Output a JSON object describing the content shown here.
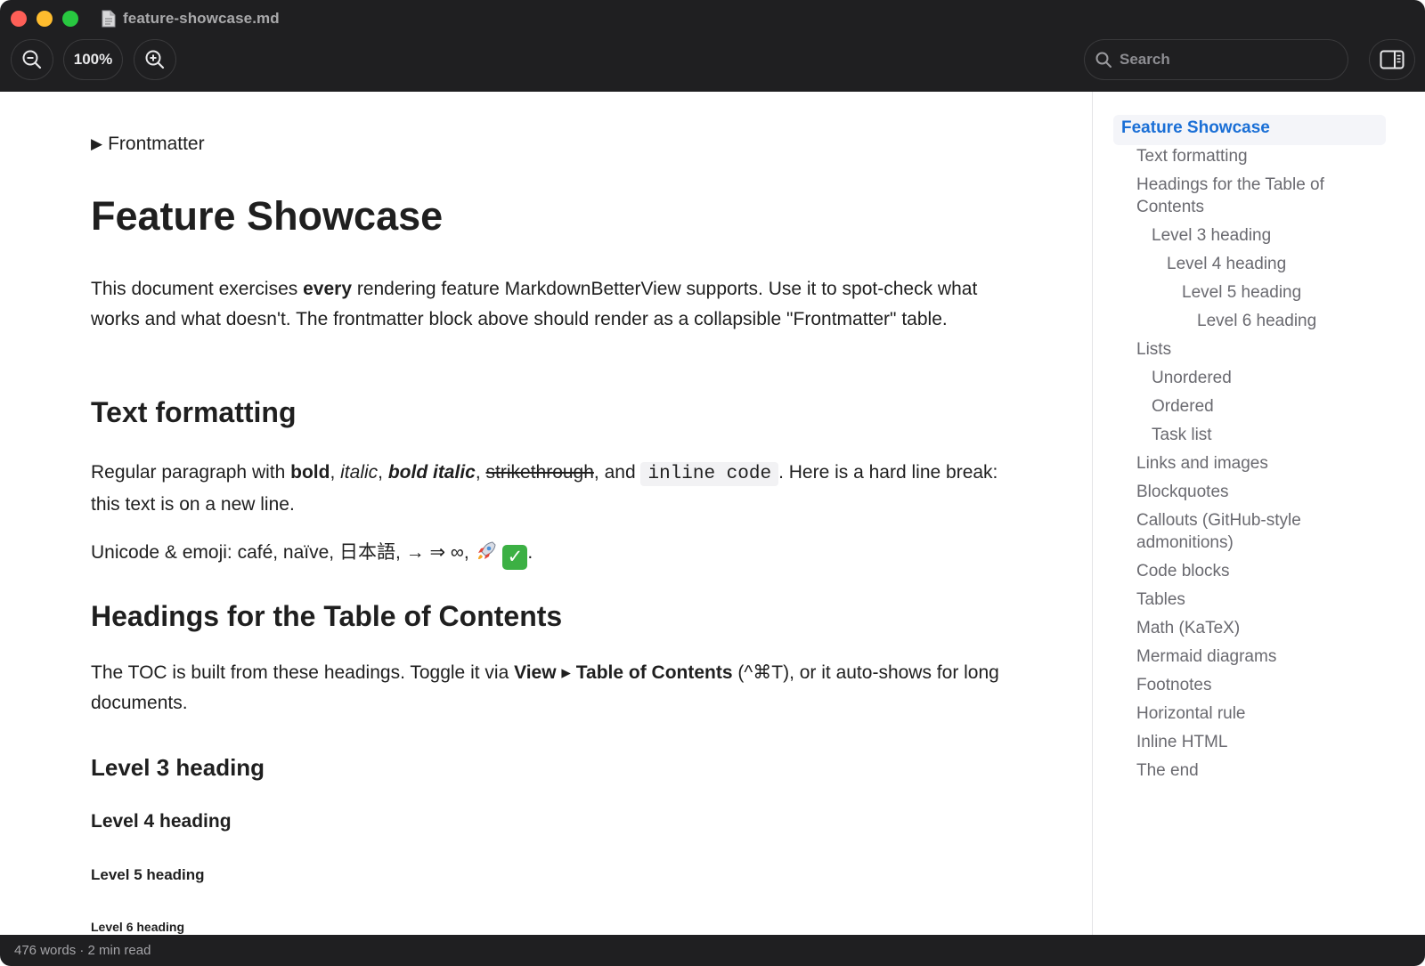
{
  "window": {
    "title": "feature-showcase.md"
  },
  "toolbar": {
    "zoom_level": "100%",
    "search_placeholder": "Search"
  },
  "content": {
    "frontmatter_label": "Frontmatter",
    "title": "Feature Showcase",
    "intro": {
      "t1": "This document exercises ",
      "b1": "every",
      "t2": " rendering feature MarkdownBetterView supports. Use it to spot-check what works and what doesn't. The frontmatter block above should render as a collapsible \"Frontmatter\" table."
    },
    "text_formatting_heading": "Text formatting",
    "formatting": {
      "t1": "Regular paragraph with ",
      "bold": "bold",
      "sep1": ", ",
      "italic": "italic",
      "sep2": ", ",
      "bold_italic": "bold italic",
      "sep3": ", ",
      "strike": "strikethrough",
      "t2": ", and ",
      "code": "inline code",
      "t3": ". Here is a hard line break: this text is on a new line."
    },
    "unicode_line": "Unicode & emoji: café, naïve, 日本語, → ⇒ ∞, ",
    "unicode_end": ".",
    "toc_heading": "Headings for the Table of Contents",
    "toc_para": {
      "t1": "The TOC is built from these headings. Toggle it via ",
      "b1": "View ▸ Table of Contents",
      "t2": " (^⌘T), or it auto-shows for long documents."
    },
    "h3": "Level 3 heading",
    "h4": "Level 4 heading",
    "h5": "Level 5 heading",
    "h6": "Level 6 heading"
  },
  "toc": [
    {
      "label": "Feature Showcase",
      "active": true
    },
    {
      "label": "Text formatting"
    },
    {
      "label": "Headings for the Table of"
    },
    {
      "label": "Contents"
    },
    {
      "label": "Level 3 heading"
    },
    {
      "label": "Level 4 heading"
    },
    {
      "label": "Level 5 heading"
    },
    {
      "label": "Level 6 heading"
    },
    {
      "label": "Lists"
    },
    {
      "label": "Unordered"
    },
    {
      "label": "Ordered"
    },
    {
      "label": "Task list"
    },
    {
      "label": "Links and images"
    },
    {
      "label": "Blockquotes"
    },
    {
      "label": "Callouts (GitHub-style"
    },
    {
      "label": "admonitions)"
    },
    {
      "label": "Code blocks"
    },
    {
      "label": "Tables"
    },
    {
      "label": "Math (KaTeX)"
    },
    {
      "label": "Mermaid diagrams"
    },
    {
      "label": "Footnotes"
    },
    {
      "label": "Horizontal rule"
    },
    {
      "label": "Inline HTML"
    },
    {
      "label": "The end"
    }
  ],
  "status": {
    "text": "476 words · 2 min read"
  },
  "colors": {
    "accent": "#1a6fd6",
    "chrome": "#1f1f21"
  },
  "icons": [
    "zoom-out-icon",
    "zoom-in-icon",
    "search-icon",
    "sidebar-toggle-icon",
    "document-icon"
  ]
}
